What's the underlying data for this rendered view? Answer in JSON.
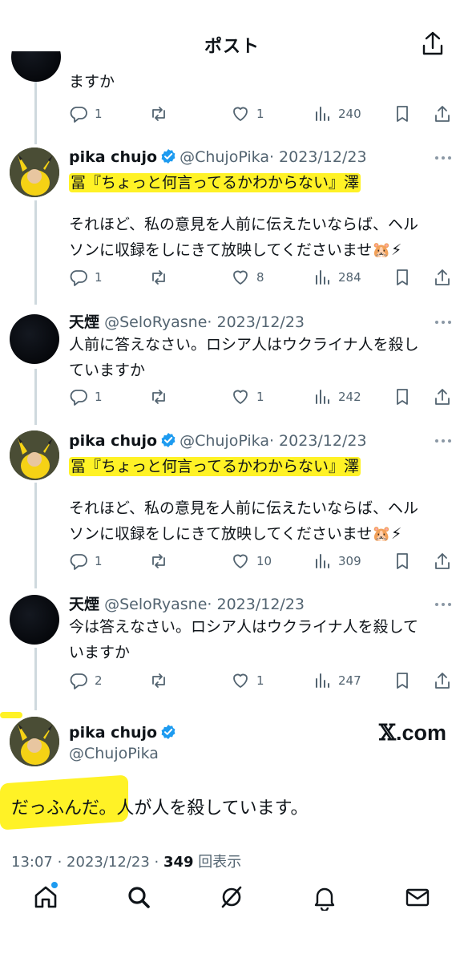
{
  "header": {
    "title": "ポスト"
  },
  "tweets": [
    {
      "text": "ますか",
      "reply_count": "1",
      "like_count": "1",
      "view_count": "240"
    },
    {
      "name": "pika chujo",
      "handle": "@ChujoPika",
      "date": "· 2023/12/23",
      "highlight": "冨『ちょっと何言ってるかわからない』澤",
      "line1": "それほど、私の意見を人前に伝えたいならば、ヘル",
      "line2": "ソンに収録をしにきて放映してくださいませ🐹⚡",
      "reply_count": "1",
      "like_count": "8",
      "view_count": "284"
    },
    {
      "name": "天煙",
      "handle": "@SeloRyasne",
      "date": "· 2023/12/23",
      "line1": "人前に答えなさい。ロシア人はウクライナ人を殺し",
      "line2": "ていますか",
      "reply_count": "1",
      "like_count": "1",
      "view_count": "242"
    },
    {
      "name": "pika chujo",
      "handle": "@ChujoPika",
      "date": "· 2023/12/23",
      "highlight": "冨『ちょっと何言ってるかわからない』澤",
      "line1": "それほど、私の意見を人前に伝えたいならば、ヘル",
      "line2": "ソンに収録をしにきて放映してくださいませ🐹⚡",
      "reply_count": "1",
      "like_count": "10",
      "view_count": "309"
    },
    {
      "name": "天煙",
      "handle": "@SeloRyasne",
      "date": "· 2023/12/23",
      "line1": "今は答えなさい。ロシア人はウクライナ人を殺して",
      "line2": "いますか",
      "reply_count": "2",
      "like_count": "1",
      "view_count": "247"
    }
  ],
  "main_post": {
    "name": "pika chujo",
    "handle": "@ChujoPika",
    "text": "だっふんだ。人が人を殺しています。",
    "time": "13:07 · 2023/12/23 · ",
    "views": "349",
    "views_label": " 回表示"
  },
  "watermark": {
    "x": "𝕏",
    "text": ".com"
  },
  "colors": {
    "accent": "#1d9bf0",
    "highlight": "#fff000",
    "muted": "#536471",
    "thread_line": "#cfd9de"
  },
  "icons": [
    "back-arrow-icon",
    "share-icon",
    "reply-icon",
    "retweet-icon",
    "heart-icon",
    "views-icon",
    "bookmark-icon",
    "verified-badge-icon",
    "more-icon",
    "home-icon",
    "search-icon",
    "grok-icon",
    "bell-icon",
    "mail-icon"
  ]
}
